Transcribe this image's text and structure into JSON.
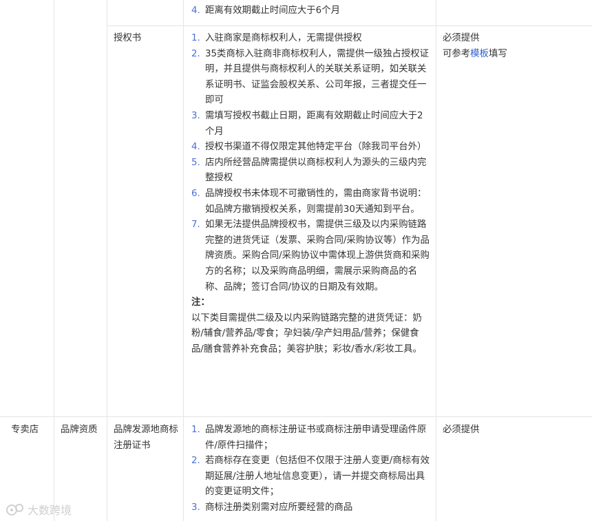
{
  "top_row": {
    "material_list": [
      {
        "num": "4.",
        "text": "距离有效期截止时间应大于6个月"
      }
    ]
  },
  "auth_row": {
    "material_name": "授权书",
    "requirements": [
      {
        "num": "1.",
        "text": "入驻商家是商标权利人，无需提供授权"
      },
      {
        "num": "2.",
        "text": "35类商标入驻商非商标权利人，需提供一级独占授权证明，并且提供与商标权利人的关联关系证明，如关联关系证明书、证监会股权关系、公司年报，三者提交任一即可"
      },
      {
        "num": "3.",
        "text": "需填写授权书截止日期，距离有效期截止时间应大于2个月"
      },
      {
        "num": "4.",
        "text": "授权书渠道不得仅限定其他特定平台（除我司平台外）"
      },
      {
        "num": "5.",
        "text": "店内所经营品牌需提供以商标权利人为源头的三级内完整授权"
      },
      {
        "num": "6.",
        "text": "品牌授权书未体现不可撤销性的，需由商家背书说明：如品牌方撤销授权关系，则需提前30天通知到平台。"
      },
      {
        "num": "7.",
        "text": "如果无法提供品牌授权书，需提供三级及以内采购链路完整的进货凭证（发票、采购合同/采购协议等）作为品牌资质。采购合同/采购协议中需体现上游供货商和采购方的名称；以及采购商品明细，需展示采购商品的名称、品牌；签订合同/协议的日期及有效期。"
      }
    ],
    "note_label": "注：",
    "note_text": "以下类目需提供二级及以内采购链路完整的进货凭证：奶粉/辅食/营养品/零食；孕妇装/孕产妇用品/营养；保健食品/膳食营养补充食品；美容护肤；彩妆/香水/彩妆工具。",
    "required_text": "必须提供",
    "ref_prefix": "可参考",
    "ref_link": "模板",
    "ref_suffix": "填写"
  },
  "store_row": {
    "store_type": "专卖店",
    "qualification_type": "品牌资质",
    "material_name": "品牌发源地商标注册证书",
    "requirements": [
      {
        "num": "1.",
        "text": "品牌发源地的商标注册证书或商标注册申请受理函件原件/原件扫描件；"
      },
      {
        "num": "2.",
        "text": "若商标存在变更（包括但不仅限于注册人变更/商标有效期延展/注册人地址信息变更），请一并提交商标局出具的变更证明文件；"
      },
      {
        "num": "3.",
        "text": "商标注册类别需对应所要经营的商品"
      }
    ],
    "required_text": "必须提供"
  },
  "watermark": {
    "text": "大数跨境",
    "icon": "logo-icon"
  }
}
